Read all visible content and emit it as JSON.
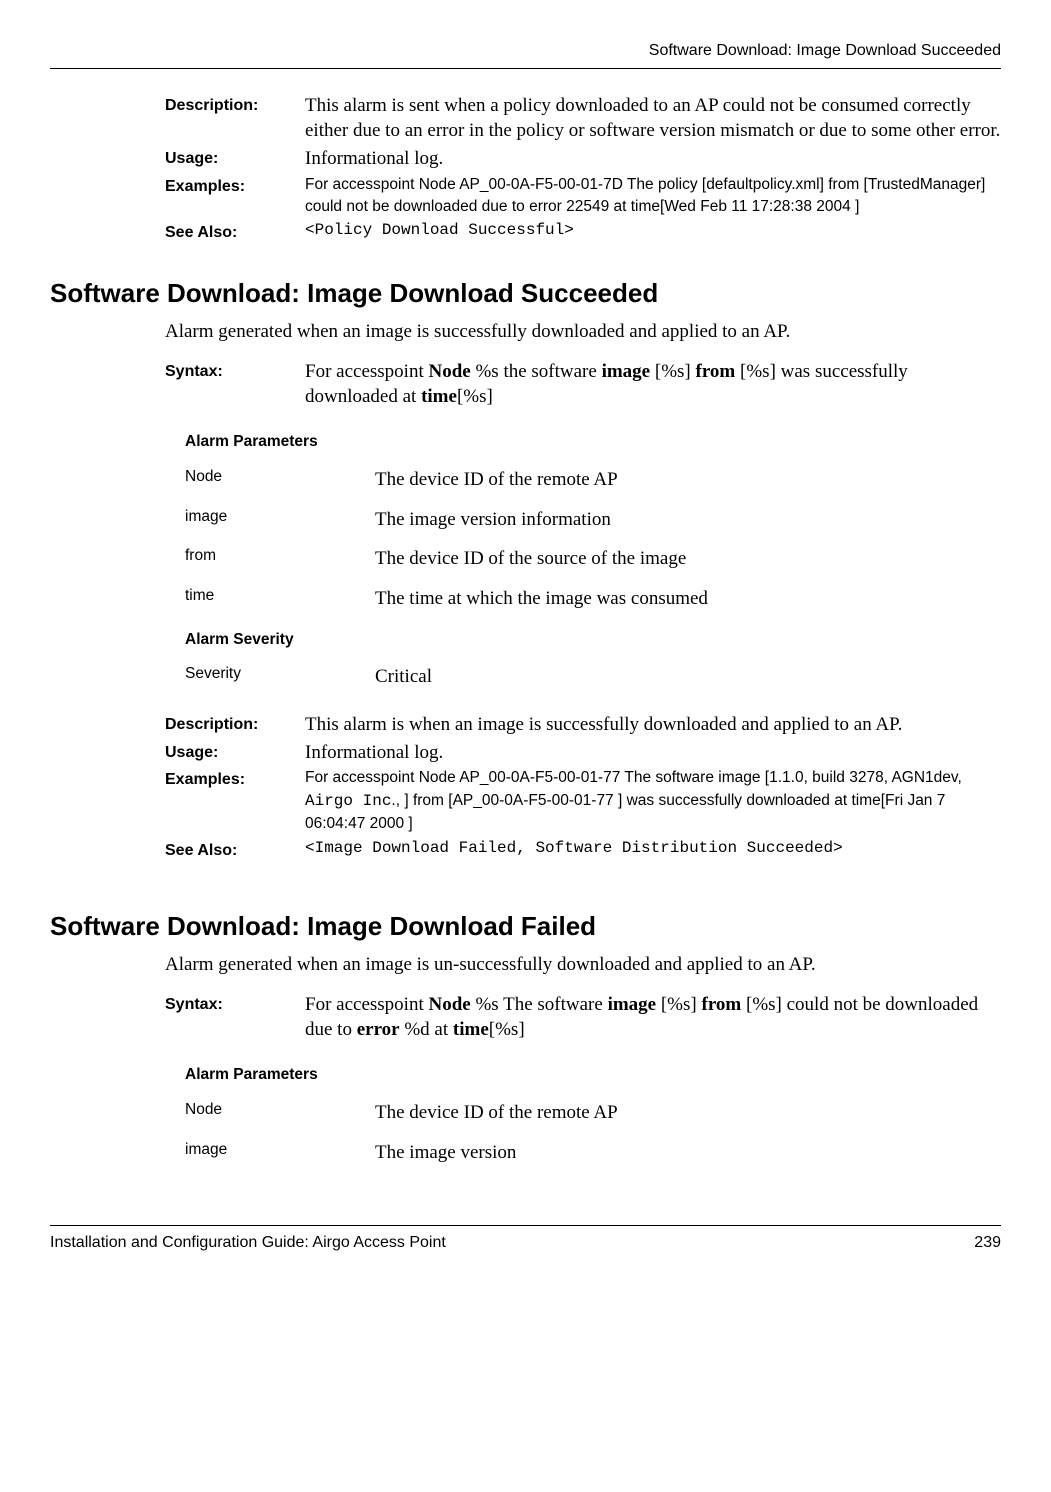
{
  "header": "Software Download: Image Download Succeeded",
  "top": {
    "description_label": "Description:",
    "description_text": "This alarm is sent when a policy downloaded to an AP could not be consumed correctly either due to an error in the policy or software version mismatch or due to some other error.",
    "usage_label": "Usage:",
    "usage_text": "Informational log.",
    "examples_label": "Examples:",
    "examples_text": "For accesspoint Node AP_00-0A-F5-00-01-7D The policy [defaultpolicy.xml] from [TrustedManager] could not be downloaded due to error 22549 at time[Wed Feb 11 17:28:38 2004 ]",
    "seealso_label": "See Also:",
    "seealso_text": "<Policy Download Successful>"
  },
  "sec1": {
    "title": "Software Download: Image Download Succeeded",
    "intro": "Alarm generated when an image is successfully downloaded and applied to an AP.",
    "syntax_label": "Syntax:",
    "syntax_pre1": "For accesspoint ",
    "syntax_b1": "Node",
    "syntax_mid1": " %s the software ",
    "syntax_b2": "image",
    "syntax_mid2": " [%s] ",
    "syntax_b3": "from",
    "syntax_mid3": " [%s] was successfully downloaded at ",
    "syntax_b4": "time",
    "syntax_post": "[%s]",
    "params_heading": "Alarm Parameters",
    "params": [
      {
        "name": "Node",
        "desc": "The device ID of the remote AP"
      },
      {
        "name": "image",
        "desc": "The image version information"
      },
      {
        "name": "from",
        "desc": "The device ID of the source of the image"
      },
      {
        "name": "time",
        "desc": "The time at which the image was consumed"
      }
    ],
    "severity_heading": "Alarm Severity",
    "severity_name": "Severity",
    "severity_value": "Critical",
    "description_label": "Description:",
    "description_text": "This alarm is when an image is successfully downloaded and applied to an AP.",
    "usage_label": "Usage:",
    "usage_text": "Informational log.",
    "examples_label": "Examples:",
    "examples_text_pre": "For accesspoint Node AP_00-0A-F5-00-01-77 The software image [1.1.0, build 3278, AGN1dev, ",
    "examples_text_mono": "Airgo Inc",
    "examples_text_post": "., ] from [AP_00-0A-F5-00-01-77 ] was successfully downloaded at time[Fri Jan 7 06:04:47 2000 ]",
    "seealso_label": "See Also:",
    "seealso_text": "<Image Download Failed, Software Distribution Succeeded>"
  },
  "sec2": {
    "title": "Software Download: Image Download Failed",
    "intro": "Alarm generated when an image is un-successfully downloaded and applied to an AP.",
    "syntax_label": "Syntax:",
    "syntax_pre1": "For accesspoint ",
    "syntax_b1": "Node",
    "syntax_mid1": " %s The software ",
    "syntax_b2": "image",
    "syntax_mid2": " [%s] ",
    "syntax_b3": "from",
    "syntax_mid3": " [%s] could not be downloaded due to ",
    "syntax_b4": "error",
    "syntax_mid4": " %d at ",
    "syntax_b5": "time",
    "syntax_post": "[%s]",
    "params_heading": "Alarm Parameters",
    "params": [
      {
        "name": "Node",
        "desc": "The device ID of the remote AP"
      },
      {
        "name": "image",
        "desc": "The image version"
      }
    ]
  },
  "footer": {
    "left": "Installation and Configuration Guide: Airgo Access Point",
    "right": "239"
  }
}
